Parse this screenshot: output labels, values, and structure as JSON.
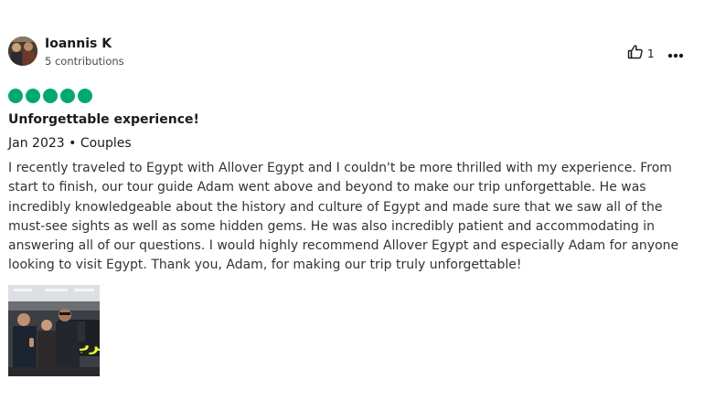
{
  "reviewer": {
    "name": "Ioannis K",
    "contributions": "5 contributions"
  },
  "helpful": {
    "icon": "thumbs-up-icon",
    "count": "1"
  },
  "more_icon": "more-horizontal-icon",
  "rating": {
    "value": 5,
    "max": 5,
    "color": "#00aa6c"
  },
  "review": {
    "title": "Unforgettable experience!",
    "meta": "Jan 2023 • Couples",
    "body": "I recently traveled to Egypt with Allover Egypt and I couldn't be more thrilled with my experience. From start to finish, our tour guide Adam went above and beyond to make our trip unforgettable. He was incredibly knowledgeable about the history and culture of Egypt and made sure that we saw all of the must-see sights as well as some hidden gems. He was also incredibly patient and accommodating in answering all of our questions. I would highly recommend Allover Egypt and especially Adam for anyone looking to visit Egypt. Thank you, Adam, for making our trip truly unforgettable!"
  },
  "photo_sign_text": "كرب"
}
